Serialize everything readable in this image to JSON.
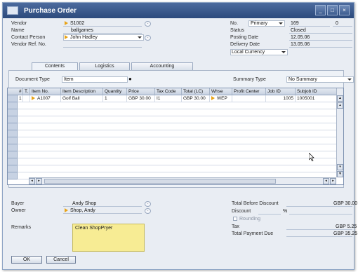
{
  "window": {
    "title": "Purchase Order",
    "controls": [
      "_",
      "□",
      "×"
    ]
  },
  "header_left": {
    "vendor_label": "Vendor",
    "vendor_value": "S1002",
    "name_label": "Name",
    "name_value": "ballgames",
    "contact_label": "Contact Person",
    "contact_value": "John Hadley",
    "vendor_ref_label": "Vendor Ref. No.",
    "vendor_ref_value": ""
  },
  "header_right": {
    "no_label": "No.",
    "no_series": "Primary",
    "no_value": "169",
    "no_extra": "0",
    "status_label": "Status",
    "status_value": "Closed",
    "posting_label": "Posting Date",
    "posting_value": "12.05.06",
    "delivery_label": "Delivery Date",
    "delivery_value": "13.05.06",
    "currency_value": "Local Currency"
  },
  "tabs": [
    {
      "label": "Contents"
    },
    {
      "label": "Logistics"
    },
    {
      "label": "Accounting"
    }
  ],
  "doc_type": {
    "label": "Document Type",
    "value": "Item"
  },
  "summary": {
    "label": "Summary Type",
    "value": "No Summary"
  },
  "grid": {
    "columns": [
      "#",
      "T.",
      "Item No.",
      "Item Description",
      "Quantity",
      "Price",
      "Tax Code",
      "Total (LC)",
      "Whse",
      "Profit Center",
      "Job ID",
      "Subjob ID"
    ],
    "rows": [
      {
        "num": "1",
        "type": "",
        "item_no": "A1007",
        "description": "Golf Ball",
        "quantity": "1",
        "price": "GBP 30.00",
        "tax_code": "I1",
        "total": "GBP 30.00",
        "whse": "WEP",
        "profit_center": "",
        "job_id": "1005",
        "subjob_id": "1005001"
      }
    ]
  },
  "footer_left": {
    "buyer_label": "Buyer",
    "buyer_value": "Andy Shop",
    "owner_label": "Owner",
    "owner_value": "Shop, Andy",
    "remarks_label": "Remarks",
    "remarks_value": "Clean ShopPryer"
  },
  "totals": {
    "before_discount_label": "Total Before Discount",
    "before_discount_value": "GBP 30.00",
    "discount_label": "Discount",
    "discount_pct": "%",
    "rounding_label": "Rounding",
    "tax_label": "Tax",
    "tax_value": "GBP 5.25",
    "total_label": "Total Payment Due",
    "total_value": "GBP 35.25"
  },
  "buttons": {
    "ok": "OK",
    "cancel": "Cancel"
  }
}
